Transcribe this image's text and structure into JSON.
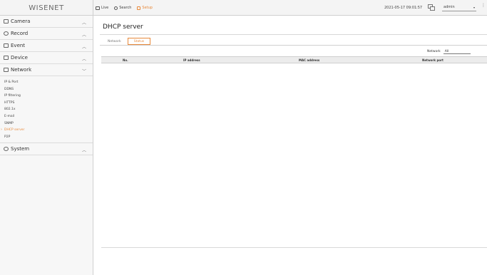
{
  "header": {
    "logo": "WISENET",
    "nav": [
      {
        "label": "Live",
        "icon": "monitor-icon"
      },
      {
        "label": "Search",
        "icon": "search-icon"
      },
      {
        "label": "Setup",
        "icon": "gear-icon"
      }
    ],
    "datetime": "2021-05-17 09:01:57",
    "user": "admin"
  },
  "sidebar": {
    "groups": [
      {
        "label": "Camera",
        "icon": "camera-icon",
        "expanded": false
      },
      {
        "label": "Record",
        "icon": "record-icon",
        "expanded": false
      },
      {
        "label": "Event",
        "icon": "event-icon",
        "expanded": false
      },
      {
        "label": "Device",
        "icon": "device-icon",
        "expanded": false
      },
      {
        "label": "Network",
        "icon": "network-icon",
        "expanded": true
      },
      {
        "label": "System",
        "icon": "system-icon",
        "expanded": false
      }
    ],
    "network_items": [
      "IP & Port",
      "DDNS",
      "IP filtering",
      "HTTPS",
      "802.1x",
      "E-mail",
      "SNMP",
      "DHCP server",
      "P2P"
    ],
    "active_item": "DHCP server"
  },
  "main": {
    "title": "DHCP server",
    "tabs": [
      "Network",
      "Status"
    ],
    "active_tab": "Status",
    "filter_label": "Network",
    "filter_value": "All",
    "columns": [
      "No.",
      "IP address",
      "MAC address",
      "Network port"
    ]
  },
  "colors": {
    "accent": "#e8893a",
    "sidebar_bg": "#f7f7f7",
    "header_bg": "#ececec"
  }
}
